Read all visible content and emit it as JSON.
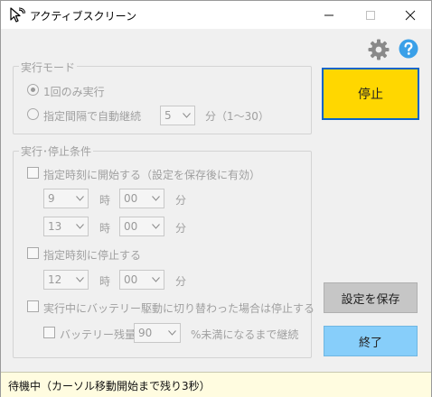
{
  "window": {
    "title": "アクティブスクリーン"
  },
  "mode_group": {
    "legend": "実行モード",
    "option_once": "1回のみ実行",
    "option_interval": "指定間隔で自動継続",
    "interval_value": "5",
    "interval_unit": "分（1～30）"
  },
  "condition_group": {
    "legend": "実行･停止条件",
    "start_at_label": "指定時刻に開始する（設定を保存後に有効）",
    "start_hour": "9",
    "start_minute": "00",
    "end_hour": "13",
    "end_minute": "00",
    "stop_at_label": "指定時刻に停止する",
    "stop_hour": "12",
    "stop_minute": "00",
    "hour_unit": "時",
    "minute_unit": "分",
    "battery_switch_label": "実行中にバッテリー駆動に切り替わった場合は停止する",
    "battery_level_label": "バッテリー残量が",
    "battery_level_value": "90",
    "battery_level_unit": "%未満になるまで継続"
  },
  "buttons": {
    "stop": "停止",
    "save": "設定を保存",
    "exit": "終了"
  },
  "colors": {
    "stop_bg": "#ffd700",
    "stop_border": "#0a64c8",
    "save_bg": "#c6c6c6",
    "exit_bg": "#87cefa",
    "help_icon": "#3aa0e8",
    "gear_icon": "#8a8a8a",
    "status_bg": "#fffce0"
  },
  "status": {
    "text": "待機中（カーソル移動開始まで残り3秒）"
  }
}
